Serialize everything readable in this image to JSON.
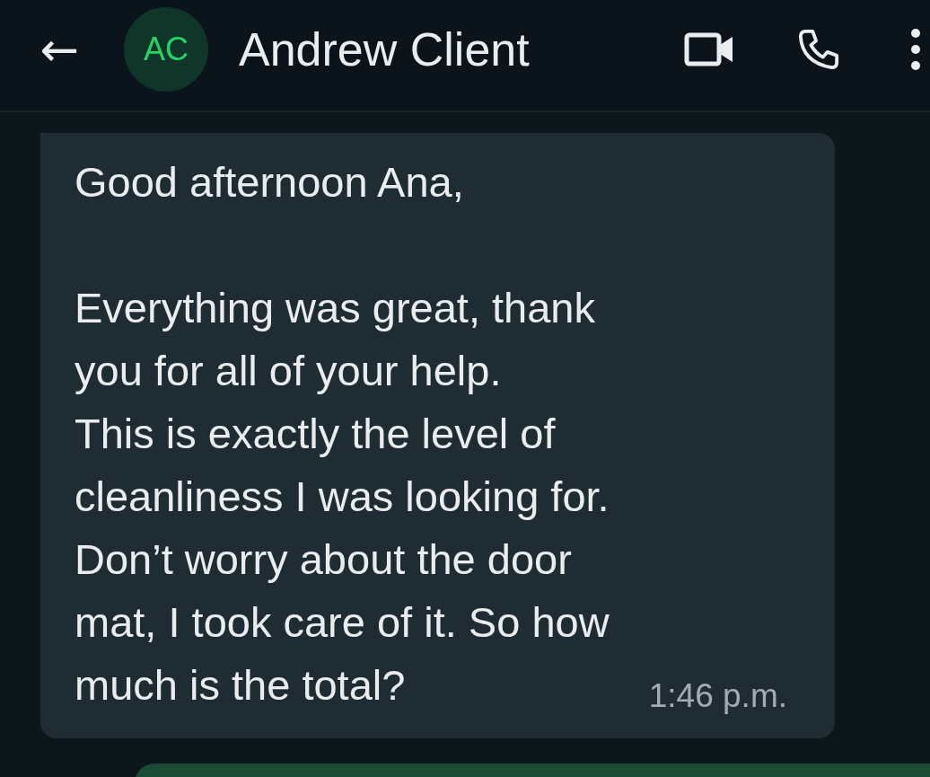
{
  "header": {
    "back_icon": "←",
    "avatar_initials": "AC",
    "contact_name": "Andrew Client"
  },
  "messages": [
    {
      "kind": "incoming",
      "text": "Good afternoon Ana,\n\nEverything was great, thank\nyou for all of your help.\nThis is exactly the level of\ncleanliness I was looking for.\nDon’t worry about the door\nmat, I took care of it. So how\nmuch is the total?",
      "time": "1:46 p.m."
    }
  ]
}
